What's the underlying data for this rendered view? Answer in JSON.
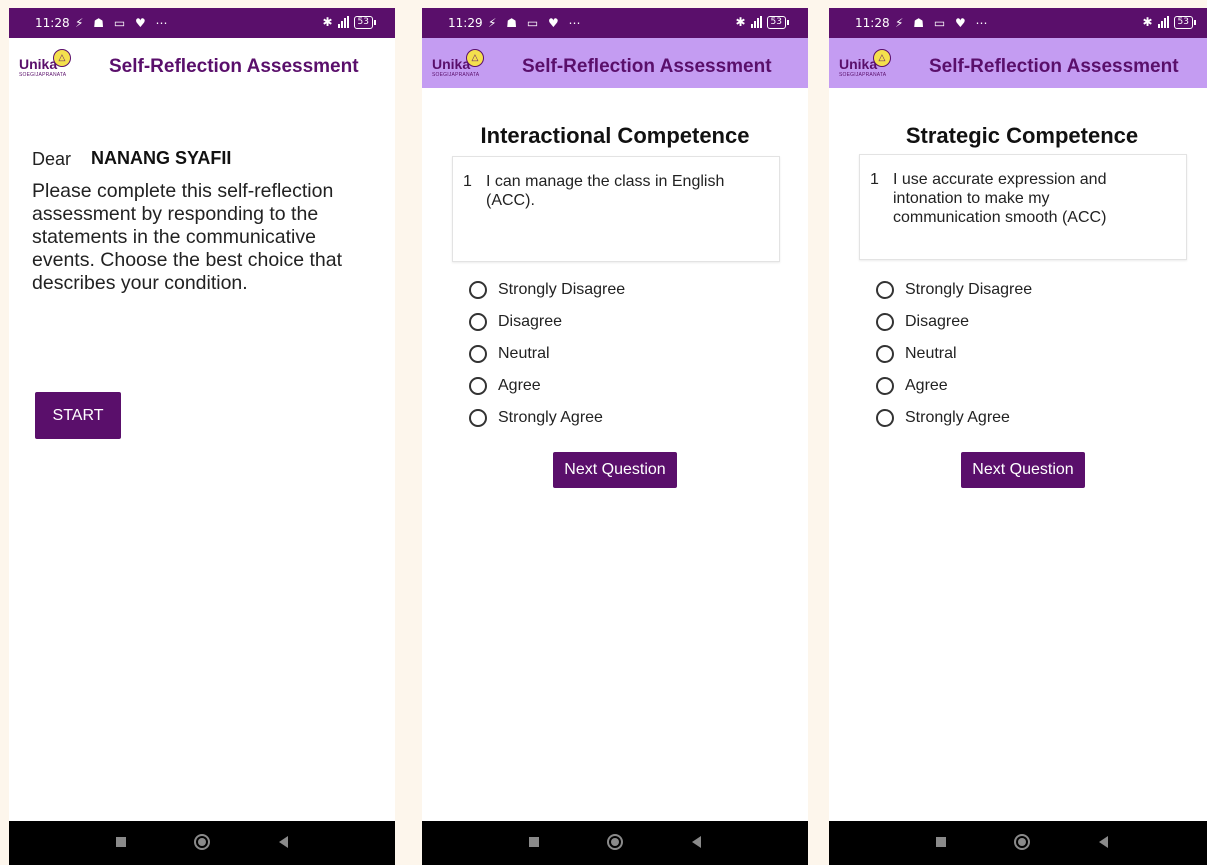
{
  "colors": {
    "primary": "#5a0f6b",
    "toolbar_light": "#c49cf2",
    "page_bg": "#fdf6ec"
  },
  "screens": [
    {
      "status_time": "11:28",
      "battery": "53",
      "logo_text": "Unika",
      "logo_sub": "SOEGIJAPRANATA",
      "title": "Self-Reflection Assessment",
      "dear_label": "Dear",
      "user_name": "NANANG SYAFII",
      "instructions": "Please complete this self-reflection assessment by responding to the statements in the communicative events. Choose the best choice that describes your condition.",
      "start_label": "START"
    },
    {
      "status_time": "11:29",
      "battery": "53",
      "logo_text": "Unika",
      "logo_sub": "SOEGIJAPRANATA",
      "title": "Self-Reflection Assessment",
      "section": "Interactional Competence",
      "question_number": "1",
      "question": "I can manage the class in English (ACC).",
      "options": [
        "Strongly Disagree",
        "Disagree",
        "Neutral",
        "Agree",
        "Strongly Agree"
      ],
      "next_label": "Next Question"
    },
    {
      "status_time": "11:28",
      "battery": "53",
      "logo_text": "Unika",
      "logo_sub": "SOEGIJAPRANATA",
      "title": "Self-Reflection Assessment",
      "section": "Strategic Competence",
      "question_number": "1",
      "question": "I use accurate expression and intonation to make my communication smooth (ACC)",
      "options": [
        "Strongly Disagree",
        "Disagree",
        "Neutral",
        "Agree",
        "Strongly Agree"
      ],
      "next_label": "Next Question"
    }
  ]
}
